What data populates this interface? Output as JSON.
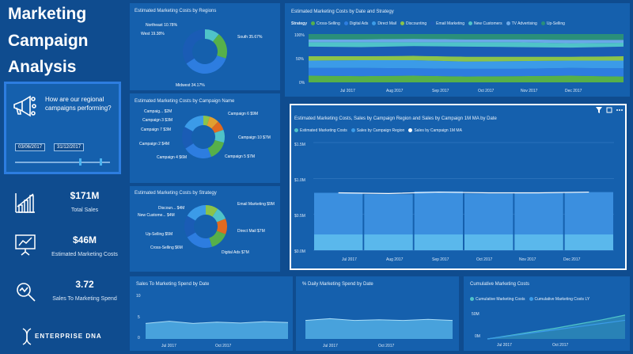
{
  "left": {
    "title_line1": "Marketing",
    "title_line2": "Campaign",
    "title_line3": "Analysis",
    "question": "How are our regional campaigns performing?",
    "date_start": "03/06/2017",
    "date_end": "31/12/2017",
    "kpis": [
      {
        "value": "$171M",
        "label": "Total Sales"
      },
      {
        "value": "$46M",
        "label": "Estimated Marketing Costs"
      },
      {
        "value": "3.72",
        "label": "Sales To Marketing Spend"
      }
    ],
    "logo_text": "ENTERPRISE DNA"
  },
  "colors": {
    "bg": "#0f4c8f",
    "panel": "#1560ad",
    "accent": "#4ab3f0",
    "highlight": "#2d7de0"
  },
  "donuts": [
    {
      "title": "Estimated Marketing Costs by Regions",
      "labels": [
        "Northeast 10.78%",
        "West 19.38%",
        "South 35.67%",
        "Midwest 34.17%"
      ],
      "chart_data": {
        "type": "pie",
        "categories": [
          "Northeast",
          "West",
          "South",
          "Midwest"
        ],
        "values": [
          10.78,
          19.38,
          35.67,
          34.17
        ],
        "colors": [
          "#4fc3c9",
          "#56b04a",
          "#2d7de0",
          "#1a5cb5"
        ]
      }
    },
    {
      "title": "Estimated Marketing Costs by Campaign Name",
      "labels": [
        "Campaig... $2M",
        "Campaign 3 $3M",
        "Campaign 7 $3M",
        "Campaign 2 $4M",
        "Campaign 4 $6M",
        "Campaign 6 $9M",
        "Campaign 10 $7M",
        "Campaign 5 $7M"
      ],
      "chart_data": {
        "type": "pie",
        "categories": [
          "Campaig...",
          "Campaign 3",
          "Campaign 7",
          "Campaign 2",
          "Campaign 4",
          "Campaign 6",
          "Campaign 10",
          "Campaign 5"
        ],
        "values": [
          2,
          3,
          3,
          4,
          6,
          9,
          7,
          7
        ],
        "colors": [
          "#8bc34a",
          "#e0a030",
          "#e06a20",
          "#4fc3c9",
          "#56b04a",
          "#2d7de0",
          "#1a5cb5",
          "#3b9be8"
        ]
      }
    },
    {
      "title": "Estimated Marketing Costs by Strategy",
      "labels": [
        "Discoun... $4M",
        "New Custome... $4M",
        "Up-Selling $5M",
        "Cross-Selling $6M",
        "Email Marketing $9M",
        "Direct Mail $7M",
        "Digital Ads $7M"
      ],
      "chart_data": {
        "type": "pie",
        "categories": [
          "Discoun...",
          "New Custome...",
          "Up-Selling",
          "Cross-Selling",
          "Email Marketing",
          "Direct Mail",
          "Digital Ads"
        ],
        "values": [
          4,
          4,
          5,
          6,
          9,
          7,
          7
        ],
        "colors": [
          "#8bc34a",
          "#4fc3c9",
          "#e06a20",
          "#56b04a",
          "#2d7de0",
          "#1a5cb5",
          "#3b9be8"
        ]
      }
    }
  ],
  "area100": {
    "title": "Estimated Marketing Costs by Date and Strategy",
    "legend_title": "Strategy",
    "legend": [
      "Cross-Selling",
      "Digital Ads",
      "Direct Mail",
      "Discounting",
      "Email Marketing",
      "New Customers",
      "TV Advertising",
      "Up-Selling"
    ],
    "yticks": [
      "100%",
      "50%",
      "0%"
    ],
    "xticks": [
      "Jul 2017",
      "Aug 2017",
      "Sep 2017",
      "Oct 2017",
      "Nov 2017",
      "Dec 2017"
    ],
    "chart_data": {
      "type": "area",
      "x": [
        "Jun 2017",
        "Jul 2017",
        "Aug 2017",
        "Sep 2017",
        "Oct 2017",
        "Nov 2017",
        "Dec 2017"
      ],
      "series": [
        {
          "name": "Cross-Selling",
          "values": [
            14,
            13,
            14,
            12,
            13,
            14,
            12
          ]
        },
        {
          "name": "Digital Ads",
          "values": [
            16,
            17,
            15,
            16,
            15,
            16,
            17
          ]
        },
        {
          "name": "Direct Mail",
          "values": [
            15,
            16,
            17,
            15,
            16,
            15,
            16
          ]
        },
        {
          "name": "Discounting",
          "values": [
            9,
            8,
            9,
            10,
            9,
            8,
            9
          ]
        },
        {
          "name": "Email Marketing",
          "values": [
            20,
            19,
            20,
            21,
            20,
            19,
            20
          ]
        },
        {
          "name": "New Customers",
          "values": [
            9,
            10,
            8,
            9,
            10,
            9,
            8
          ]
        },
        {
          "name": "TV Advertising",
          "values": [
            6,
            6,
            7,
            6,
            6,
            7,
            6
          ]
        },
        {
          "name": "Up-Selling",
          "values": [
            11,
            11,
            10,
            11,
            11,
            12,
            12
          ]
        }
      ],
      "colors": [
        "#56b04a",
        "#2d7de0",
        "#3b9be8",
        "#8bc34a",
        "#1a5cb5",
        "#4fc3c9",
        "#6aa8e8",
        "#2a8f7a"
      ],
      "ylim": [
        0,
        100
      ]
    }
  },
  "main_chart": {
    "title": "Estimated Marketing Costs, Sales by Campaign Region and Sales by Campaign 1M MA by Date",
    "legend": [
      "Estimated Marketing Costs",
      "Sales by Campaign Region",
      "Sales by Campaign 1M MA"
    ],
    "yticks": [
      "$1.5M",
      "$1.0M",
      "$0.5M",
      "$0.0M"
    ],
    "xticks": [
      "Jul 2017",
      "Aug 2017",
      "Sep 2017",
      "Oct 2017",
      "Nov 2017",
      "Dec 2017"
    ],
    "chart_data": {
      "type": "bar",
      "x": [
        "Jul 2017",
        "Aug 2017",
        "Sep 2017",
        "Oct 2017",
        "Nov 2017",
        "Dec 2017"
      ],
      "series": [
        {
          "name": "Estimated Marketing Costs",
          "values": [
            0.22,
            0.22,
            0.22,
            0.22,
            0.22,
            0.22
          ]
        },
        {
          "name": "Sales by Campaign Region",
          "values": [
            0.8,
            0.78,
            0.82,
            0.79,
            0.8,
            0.81
          ]
        },
        {
          "name": "Sales by Campaign 1M MA",
          "values": [
            0.8,
            0.79,
            0.81,
            0.8,
            0.8,
            0.81
          ]
        }
      ],
      "ylim": [
        0,
        1.5
      ]
    }
  },
  "bottom": [
    {
      "title": "Sales To Marketing Spend by Date",
      "yticks": [
        "10",
        "5",
        "0"
      ],
      "xticks": [
        "Jul 2017",
        "Oct 2017"
      ],
      "chart_data": {
        "type": "area",
        "x": [
          "Jun 2017",
          "Jul 2017",
          "Aug 2017",
          "Sep 2017",
          "Oct 2017",
          "Nov 2017",
          "Dec 2017"
        ],
        "values": [
          3.5,
          4,
          3.5,
          3.8,
          3.6,
          3.9,
          3.7
        ],
        "ylim": [
          0,
          10
        ]
      }
    },
    {
      "title": "% Daily Marketing Spend by Date",
      "xticks": [
        "Jul 2017",
        "Oct 2017"
      ],
      "chart_data": {
        "type": "area",
        "x": [
          "Jun 2017",
          "Jul 2017",
          "Aug 2017",
          "Sep 2017",
          "Oct 2017",
          "Nov 2017",
          "Dec 2017"
        ],
        "values": [
          0.5,
          0.55,
          0.5,
          0.52,
          0.5,
          0.53,
          0.5
        ],
        "ylim": [
          0,
          1.2
        ]
      }
    },
    {
      "title": "Cumulative Marketing Costs",
      "legend": [
        "Cumulative Marketing Costs",
        "Cumulative Marketing Costs LY"
      ],
      "yticks": [
        "50M",
        "0M"
      ],
      "xticks": [
        "Jul 2017",
        "Oct 2017"
      ],
      "chart_data": {
        "type": "line",
        "x": [
          "Jun 2017",
          "Jul 2017",
          "Aug 2017",
          "Sep 2017",
          "Oct 2017",
          "Nov 2017",
          "Dec 2017"
        ],
        "series": [
          {
            "name": "Cumulative Marketing Costs",
            "values": [
              0,
              7,
              14,
              21,
              29,
              37,
              46
            ]
          },
          {
            "name": "Cumulative Marketing Costs LY",
            "values": [
              0,
              6,
              12,
              18,
              24,
              30,
              36
            ]
          }
        ],
        "ylim": [
          0,
          55
        ]
      }
    }
  ]
}
